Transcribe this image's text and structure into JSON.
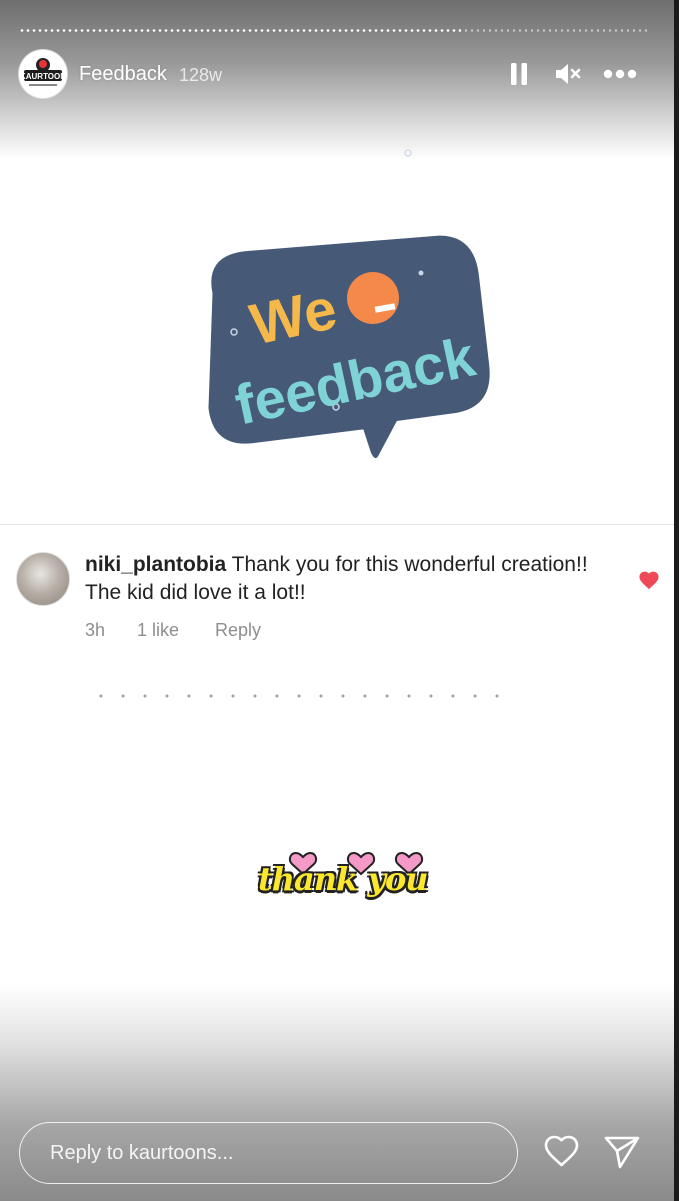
{
  "story": {
    "account_badge": "KAURTOON",
    "title": "Feedback",
    "age": "128w",
    "progress": 0.7
  },
  "controls": {
    "pause_icon": "pause-icon",
    "mute_icon": "muted-speaker-icon",
    "more_icon": "more-options-icon"
  },
  "feedback_image": {
    "line1": "We",
    "line2": "feedback",
    "bubble_color": "#465a78",
    "we_color": "#f4b94a",
    "feedback_color": "#7fd3d6",
    "dot_color": "#f4894a"
  },
  "comment": {
    "username": "niki_plantobia",
    "text": " Thank you for this wonderful creation!! The kid did love it a lot!!",
    "time": "3h",
    "likes": "1 like",
    "reply": "Reply",
    "liked": true,
    "heart_color": "#ed4956"
  },
  "sticker": {
    "text": "thank you",
    "heart_color": "#f59ac8"
  },
  "reply_bar": {
    "placeholder": "Reply to kaurtoons...",
    "like_icon": "heart-outline-icon",
    "send_icon": "send-icon"
  }
}
